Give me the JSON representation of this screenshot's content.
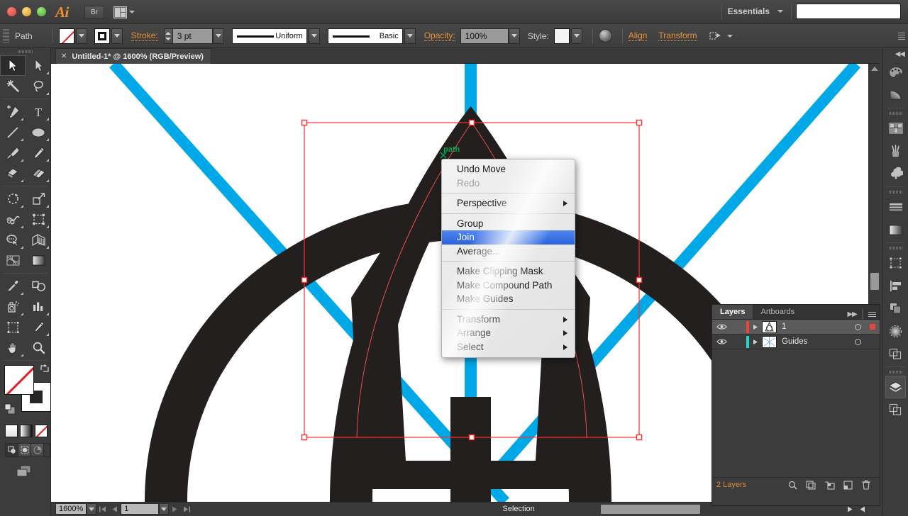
{
  "titlebar": {
    "app_icon": "Ai",
    "bridge_label": "Br",
    "arrange_icon": "arrange-documents-icon",
    "workspace_label": "Essentials",
    "search_value": ""
  },
  "controlbar": {
    "object_type": "Path",
    "fill_icon": "none-swatch-icon",
    "stroke_icon": "stroke-swatch-icon",
    "stroke_label": "Stroke:",
    "stroke_weight": "3 pt",
    "variable_width_profile": "Uniform",
    "brush_definition": "Basic",
    "opacity_label": "Opacity:",
    "opacity_value": "100%",
    "style_label": "Style:",
    "align_label": "Align",
    "transform_label": "Transform",
    "recolor_icon": "recolor-artwork-icon",
    "document_setup_icon": "document-setup-icon"
  },
  "tab": {
    "close_icon": "close-icon",
    "title": "Untitled-1* @ 1600% (RGB/Preview)"
  },
  "toolbar": {
    "tools": [
      {
        "name": "selection-tool",
        "selected": true
      },
      {
        "name": "direct-selection-tool",
        "selected": false
      },
      {
        "name": "magic-wand-tool",
        "selected": false
      },
      {
        "name": "lasso-tool",
        "selected": false
      },
      {
        "name": "pen-tool",
        "selected": false
      },
      {
        "name": "type-tool",
        "selected": false
      },
      {
        "name": "line-segment-tool",
        "selected": false
      },
      {
        "name": "ellipse-tool",
        "selected": false
      },
      {
        "name": "paintbrush-tool",
        "selected": false
      },
      {
        "name": "pencil-tool",
        "selected": false
      },
      {
        "name": "blob-brush-tool",
        "selected": false
      },
      {
        "name": "eraser-tool",
        "selected": false
      },
      {
        "name": "rotate-tool",
        "selected": false
      },
      {
        "name": "scale-tool",
        "selected": false
      },
      {
        "name": "width-tool",
        "selected": false
      },
      {
        "name": "free-transform-tool",
        "selected": false
      },
      {
        "name": "shape-builder-tool",
        "selected": false
      },
      {
        "name": "perspective-grid-tool",
        "selected": false
      },
      {
        "name": "mesh-tool",
        "selected": false
      },
      {
        "name": "gradient-tool",
        "selected": false
      },
      {
        "name": "eyedropper-tool",
        "selected": false
      },
      {
        "name": "blend-tool",
        "selected": false
      },
      {
        "name": "symbol-sprayer-tool",
        "selected": false
      },
      {
        "name": "column-graph-tool",
        "selected": false
      },
      {
        "name": "artboard-tool",
        "selected": false
      },
      {
        "name": "slice-tool",
        "selected": false
      },
      {
        "name": "hand-tool",
        "selected": false
      },
      {
        "name": "zoom-tool",
        "selected": false
      }
    ],
    "fill_swatch": "none",
    "stroke_swatch": "black",
    "swap_icon": "swap-fill-stroke-icon",
    "default_icon": "default-fill-stroke-icon",
    "color_modes": [
      "color-swatch",
      "gradient-swatch",
      "none-swatch"
    ],
    "draw_modes": [
      "draw-normal",
      "draw-behind",
      "draw-inside"
    ],
    "screen_mode_icon": "change-screen-mode-icon"
  },
  "context_menu": {
    "groups": [
      [
        {
          "label": "Undo Move",
          "disabled": false,
          "submenu": false,
          "highlighted": false
        },
        {
          "label": "Redo",
          "disabled": true,
          "submenu": false,
          "highlighted": false
        }
      ],
      [
        {
          "label": "Perspective",
          "disabled": false,
          "submenu": true,
          "highlighted": false
        }
      ],
      [
        {
          "label": "Group",
          "disabled": false,
          "submenu": false,
          "highlighted": false
        },
        {
          "label": "Join",
          "disabled": false,
          "submenu": false,
          "highlighted": true
        },
        {
          "label": "Average...",
          "disabled": false,
          "submenu": false,
          "highlighted": false
        }
      ],
      [
        {
          "label": "Make Clipping Mask",
          "disabled": false,
          "submenu": false,
          "highlighted": false
        },
        {
          "label": "Make Compound Path",
          "disabled": false,
          "submenu": false,
          "highlighted": false
        },
        {
          "label": "Make Guides",
          "disabled": false,
          "submenu": false,
          "highlighted": false
        }
      ],
      [
        {
          "label": "Transform",
          "disabled": false,
          "submenu": true,
          "highlighted": false
        },
        {
          "label": "Arrange",
          "disabled": false,
          "submenu": true,
          "highlighted": false
        },
        {
          "label": "Select",
          "disabled": false,
          "submenu": true,
          "highlighted": false
        }
      ]
    ]
  },
  "canvas": {
    "smart_guide_label": "path",
    "guide_color": "#00a8e8",
    "artwork_color": "#231f1f",
    "selection_color": "#ff2d2d"
  },
  "layers_panel": {
    "tabs": [
      {
        "label": "Layers",
        "active": true
      },
      {
        "label": "Artboards",
        "active": false
      }
    ],
    "collapse_icon": "double-arrow-icon",
    "panel_menu_icon": "panel-menu-icon",
    "rows": [
      {
        "name": "1",
        "selected": true,
        "color": "#e8453c",
        "has_target_indicator": true,
        "thumb": "artwork-thumbnail"
      },
      {
        "name": "Guides",
        "selected": false,
        "color": "#2ad2c9",
        "has_target_indicator": false,
        "thumb": "guides-thumbnail"
      }
    ],
    "footer": {
      "count_label": "2 Layers",
      "buttons": [
        {
          "name": "locate-object-button",
          "icon": "magnifier-icon"
        },
        {
          "name": "make-release-clipping-mask-button",
          "icon": "clipping-mask-icon"
        },
        {
          "name": "create-new-sublayer-button",
          "icon": "new-sublayer-icon"
        },
        {
          "name": "create-new-layer-button",
          "icon": "new-layer-icon"
        },
        {
          "name": "delete-selection-button",
          "icon": "trash-icon"
        }
      ]
    }
  },
  "dock": {
    "groups": [
      [
        {
          "name": "color-panel-icon",
          "active": false
        },
        {
          "name": "color-guide-panel-icon",
          "active": false
        }
      ],
      [
        {
          "name": "swatches-panel-icon",
          "active": false
        },
        {
          "name": "brushes-panel-icon",
          "active": false
        },
        {
          "name": "symbols-panel-icon",
          "active": false
        }
      ],
      [
        {
          "name": "stroke-panel-icon",
          "active": false
        },
        {
          "name": "gradient-panel-icon",
          "active": false
        }
      ],
      [
        {
          "name": "transform-panel-icon",
          "active": false
        },
        {
          "name": "align-panel-icon",
          "active": false
        },
        {
          "name": "pathfinder-panel-icon",
          "active": false
        },
        {
          "name": "transparency-panel-icon",
          "active": false
        },
        {
          "name": "appearance-panel-icon",
          "active": false
        }
      ],
      [
        {
          "name": "layers-panel-icon",
          "active": true
        },
        {
          "name": "artboards-panel-icon",
          "active": false
        }
      ]
    ]
  },
  "statusbar": {
    "zoom_level": "1600%",
    "first_page_icon": "first-page-icon",
    "prev_page_icon": "previous-page-icon",
    "page_value": "1",
    "next_page_icon": "next-page-icon",
    "last_page_icon": "last-page-icon",
    "status_text": "Selection"
  }
}
